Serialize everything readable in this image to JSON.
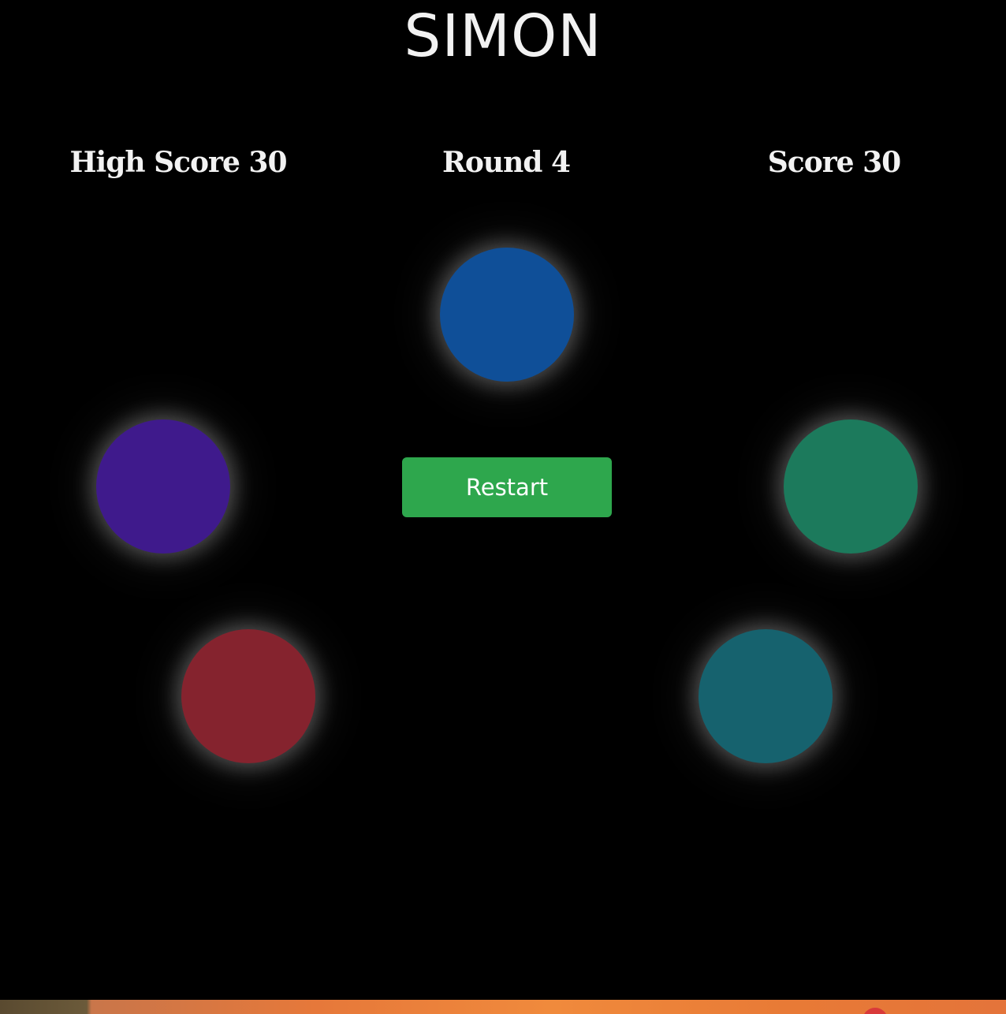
{
  "game": {
    "title": "SIMON",
    "high_score_label": "High Score 30",
    "round_label": "Round 4",
    "score_label": "Score 30",
    "restart_label": "Restart"
  },
  "pads": [
    {
      "name": "blue",
      "color": "#0f4f98"
    },
    {
      "name": "purple",
      "color": "#3f1a8c"
    },
    {
      "name": "green",
      "color": "#1c7a5c"
    },
    {
      "name": "red",
      "color": "#85232e"
    },
    {
      "name": "teal",
      "color": "#16626e"
    }
  ],
  "colors": {
    "background": "#000000",
    "text": "#f2f2f2",
    "restart_button": "#2ea74d"
  }
}
